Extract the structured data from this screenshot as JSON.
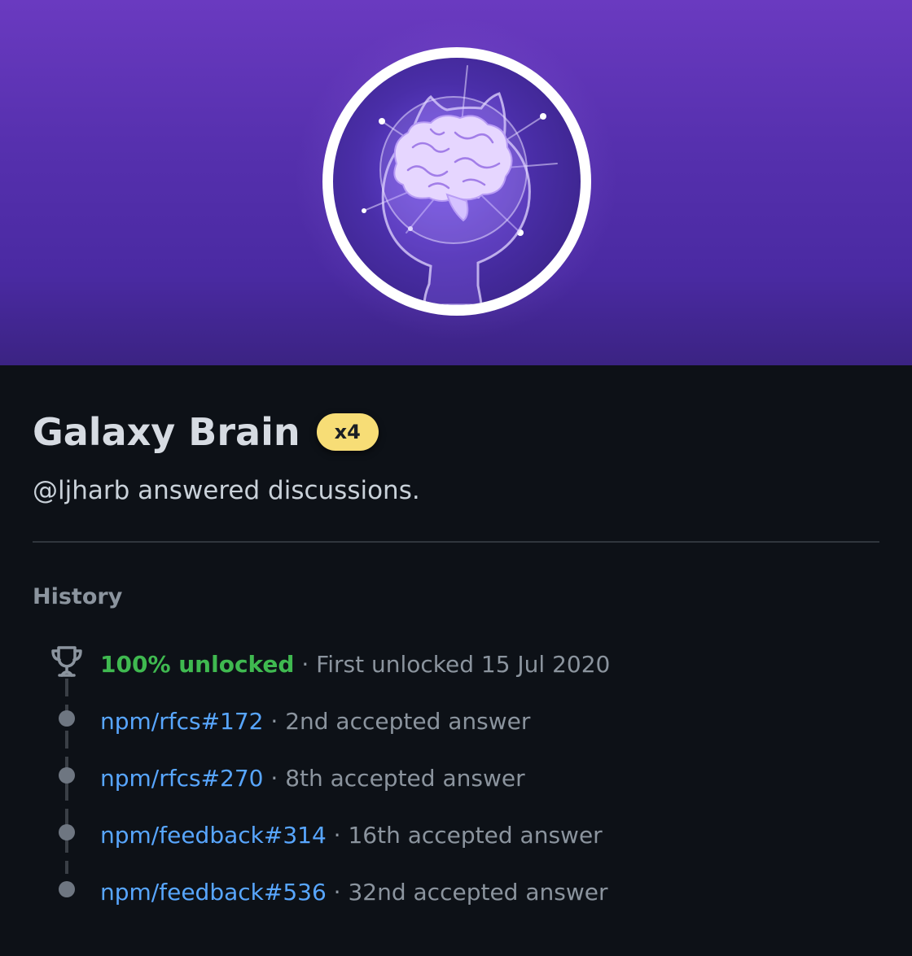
{
  "achievement": {
    "title": "Galaxy Brain",
    "count_badge": "x4",
    "description": "@ljharb answered discussions.",
    "badge_icon": "galaxy-brain-icon",
    "colors": {
      "hero_top": "#6a3ac0",
      "hero_bottom": "#3b2383",
      "count_badge_bg": "#f7dd76",
      "unlocked_green": "#3fb950",
      "link_blue": "#58a6ff"
    }
  },
  "history": {
    "label": "History",
    "unlocked": {
      "icon": "trophy-icon",
      "status": "100% unlocked",
      "separator": " · ",
      "detail": "First unlocked 15 Jul 2020"
    },
    "items": [
      {
        "link": "npm/rfcs#172",
        "separator": " · ",
        "detail": "2nd accepted answer"
      },
      {
        "link": "npm/rfcs#270",
        "separator": " · ",
        "detail": "8th accepted answer"
      },
      {
        "link": "npm/feedback#314",
        "separator": " · ",
        "detail": "16th accepted answer"
      },
      {
        "link": "npm/feedback#536",
        "separator": " · ",
        "detail": "32nd accepted answer"
      }
    ]
  }
}
